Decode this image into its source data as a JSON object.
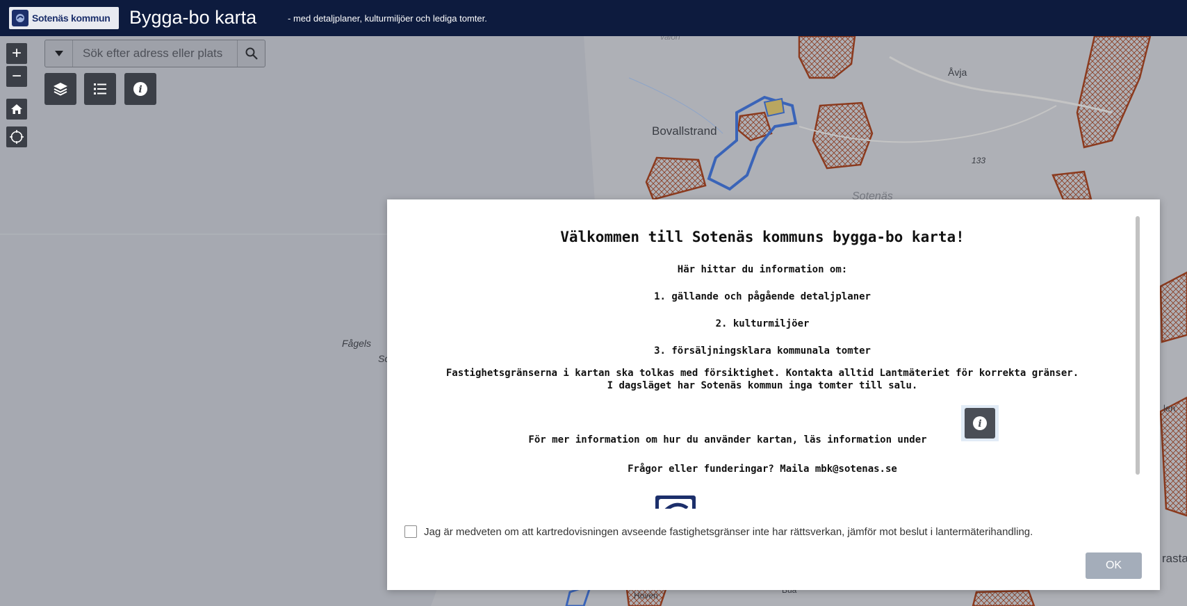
{
  "header": {
    "logo_text": "Sotenäs kommun",
    "title": "Bygga-bo karta",
    "subtitle": "- med detaljplaner, kulturmiljöer och lediga tomter."
  },
  "search": {
    "placeholder": "Sök efter adress eller plats",
    "dropdown_icon": "caret-down-icon",
    "search_icon": "magnifier-icon"
  },
  "map_controls": {
    "zoom_in": "+",
    "zoom_out": "−",
    "home_icon": "home-icon",
    "locate_icon": "crosshair-icon",
    "layers_icon": "layers-icon",
    "legend_icon": "list-icon",
    "info_icon": "info-icon"
  },
  "map_labels": {
    "boval": "Bovallstrand",
    "avja": "Åvja",
    "elev": "133",
    "sotenas": "Sotenäs",
    "fagels": "Fågels",
    "so": "So",
    "hoven": "Hoven",
    "bua": "Bua",
    "rasta": "rasta",
    "len": "len",
    "valon": "valon"
  },
  "dialog": {
    "title": "Välkommen till Sotenäs kommuns bygga-bo karta!",
    "intro": "Här hittar du information om:",
    "item1": "1. gällande och pågående detaljplaner",
    "item2": "2. kulturmiljöer",
    "item3": "3. försäljningsklara kommunala tomter",
    "note1": "Fastighetsgränserna i kartan ska tolkas med försiktighet. Kontakta alltid Lantmäteriet för korrekta gränser.",
    "note2": "I dagsläget har Sotenäs kommun inga tomter till salu.",
    "more_info": "För mer information om hur du använder kartan, läs information under",
    "contact": "Frågor eller funderingar? Maila mbk@sotenas.se",
    "consent": "Jag är medveten om att kartredovisningen avseende fastighetsgränser inte har rättsverkan, jämför mot beslut i lantermäterihandling.",
    "ok_label": "OK"
  },
  "colors": {
    "header_bg": "#0d1b3e",
    "map_overlay": "#a7aab2",
    "hatch_red": "#8b3a1e",
    "plan_blue": "#3a64b8",
    "ok_button": "#a4adba"
  }
}
